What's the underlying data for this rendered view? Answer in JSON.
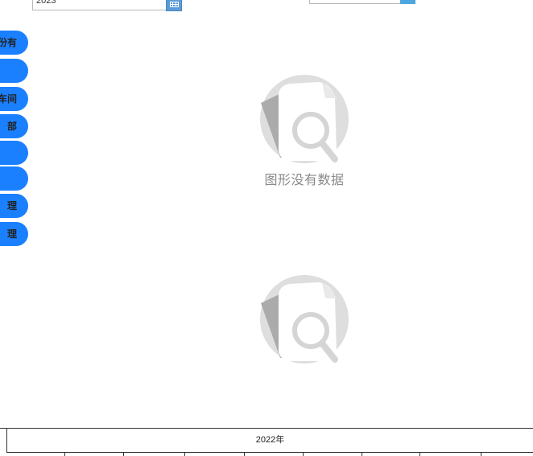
{
  "filters": {
    "year_value": "2023"
  },
  "sidebar": {
    "items": [
      {
        "label": "份有"
      },
      {
        "label": ""
      },
      {
        "label": "车间"
      },
      {
        "label": "部"
      },
      {
        "label": ""
      },
      {
        "label": ""
      },
      {
        "label": "理"
      },
      {
        "label": "理"
      }
    ]
  },
  "charts": [
    {
      "empty_text": "图形没有数据"
    },
    {
      "empty_text": ""
    }
  ],
  "table": {
    "header_year": "2022年"
  },
  "colors": {
    "side_button": "#1a80ff",
    "calendar_button": "#5b9bd5",
    "empty_icon_gray": "#dcdcdc"
  },
  "icons": {
    "calendar": "calendar-icon",
    "empty": "no-data-magnifier-icon"
  }
}
